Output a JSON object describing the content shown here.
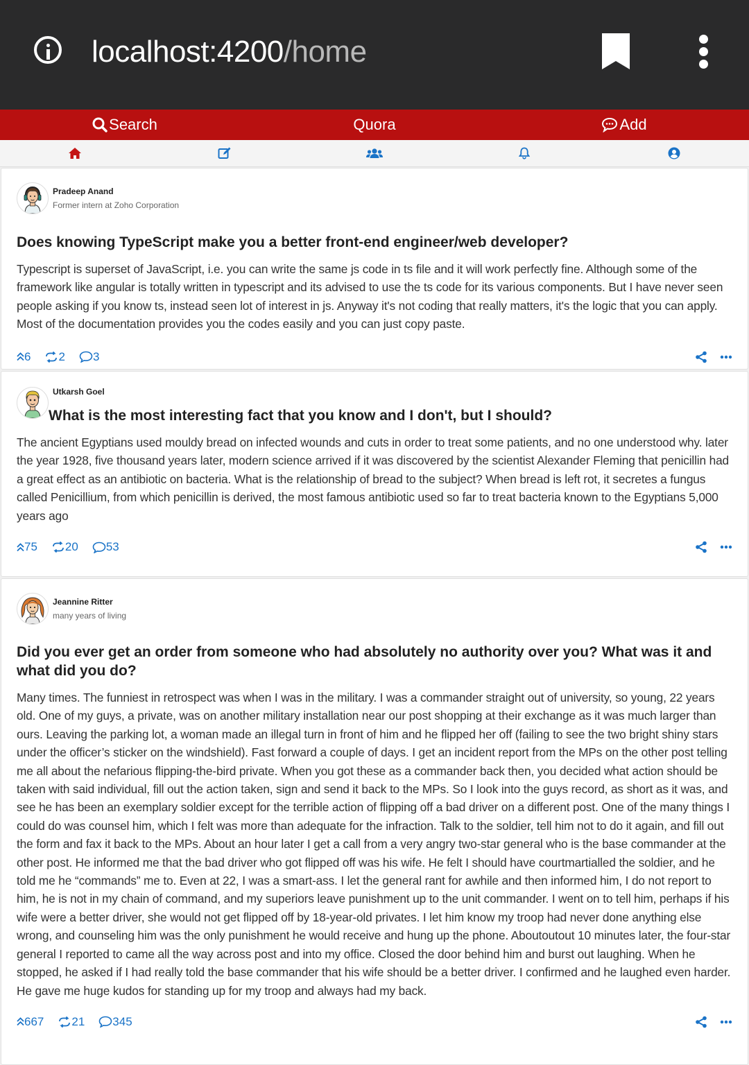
{
  "browser": {
    "url_host": "localhost:4200",
    "url_path": "/home"
  },
  "nav": {
    "search": "Search",
    "brand": "Quora",
    "add": "Add"
  },
  "posts": [
    {
      "author": "Pradeep Anand",
      "credential": "Former intern at Zoho Corporation",
      "question": "Does knowing TypeScript make you a better front-end engineer/web developer?",
      "answer": "Typescript is superset of JavaScript, i.e. you can write the same js code in ts file and it will work perfectly fine. Although some of the framework like angular is totally written in typescript and its advised to use the ts code for its various components. But I have never seen people asking if you know ts, instead seen lot of interest in js. Anyway it's not coding that really matters, it's the logic that you can apply. Most of the documentation provides you the codes easily and you can just copy paste.",
      "upvotes": "6",
      "shares": "2",
      "comments": "3"
    },
    {
      "author": "Utkarsh Goel",
      "credential": "",
      "question": "What is the most interesting fact that you know and I don't, but I should?",
      "answer": "The ancient Egyptians used mouldy bread on infected wounds and cuts in order to treat some patients, and no one understood why. later the year 1928, five thousand years later, modern science arrived if it was discovered by the scientist Alexander Fleming that penicillin had a great effect as an antibiotic on bacteria. What is the relationship of bread to the subject? When bread is left rot, it secretes a fungus called Penicillium, from which penicillin is derived, the most famous antibiotic used so far to treat bacteria known to the Egyptians 5,000 years ago",
      "upvotes": "75",
      "shares": "20",
      "comments": "53"
    },
    {
      "author": "Jeannine Ritter",
      "credential": "many years of living",
      "question": "Did you ever get an order from someone who had absolutely no authority over you? What was it and what did you do?",
      "answer": "Many times. The funniest in retrospect was when I was in the military. I was a commander straight out of university, so young, 22 years old. One of my guys, a private, was on another military installation near our post shopping at their exchange as it was much larger than ours. Leaving the parking lot, a woman made an illegal turn in front of him and he flipped her off (failing to see the two bright shiny stars under the officer’s sticker on the windshield). Fast forward a couple of days. I get an incident report from the MPs on the other post telling me all about the nefarious flipping-the-bird private. When you got these as a commander back then, you decided what action should be taken with said individual, fill out the action taken, sign and send it back to the MPs. So I look into the guys record, as short as it was, and see he has been an exemplary soldier except for the terrible action of flipping off a bad driver on a different post. One of the many things I could do was counsel him, which I felt was more than adequate for the infraction. Talk to the soldier, tell him not to do it again, and fill out the form and fax it back to the MPs. About an hour later I get a call from a very angry two-star general who is the base commander at the other post. He informed me that the bad driver who got flipped off was his wife. He felt I should have courtmartialled the soldier, and he told me he “commands” me to. Even at 22, I was a smart-ass. I let the general rant for awhile and then informed him, I do not report to him, he is not in my chain of command, and my superiors leave punishment up to the unit commander. I went on to tell him, perhaps if his wife were a better driver, she would not get flipped off by 18-year-old privates. I let him know my troop had never done anything else wrong, and counseling him was the only punishment he would receive and hung up the phone. Aboutoutout 10 minutes later, the four-star general I reported to came all the way across post and into my office. Closed the door behind him and burst out laughing. When he stopped, he asked if I had really told the base commander that his wife should be a better driver. I confirmed and he laughed even harder. He gave me huge kudos for standing up for my troop and always had my back.",
      "upvotes": "667",
      "shares": "21",
      "comments": "345"
    }
  ],
  "icons": {
    "browser": [
      "info-icon",
      "bookmark-icon",
      "overflow-menu-icon"
    ],
    "nav": [
      "search-icon",
      "chat-icon",
      "home-icon",
      "edit-icon",
      "users-icon",
      "bell-icon",
      "profile-icon"
    ],
    "post": [
      "upvote-icon",
      "reshare-icon",
      "comment-icon",
      "share-icon",
      "more-icon"
    ]
  },
  "colors": {
    "accent_red": "#b81010",
    "link_blue": "#1a73c7",
    "browser_bar": "#2a2a2b"
  }
}
